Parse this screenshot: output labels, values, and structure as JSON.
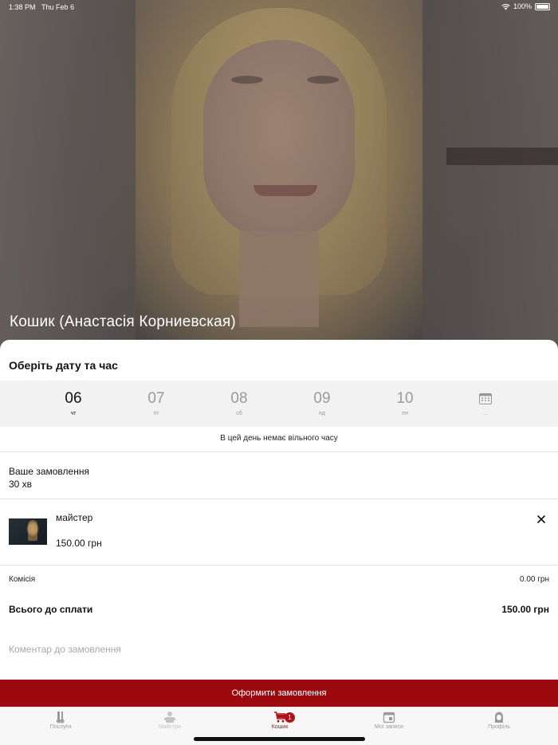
{
  "status_bar": {
    "time": "1:38 PM",
    "date": "Thu Feb 6",
    "battery": "100%"
  },
  "hero": {
    "title": "Кошик (Анастасія Корниевская)"
  },
  "booking": {
    "title": "Оберіть дату та час",
    "days": [
      {
        "num": "06",
        "weekday": "чт",
        "active": true
      },
      {
        "num": "07",
        "weekday": "пт",
        "active": false
      },
      {
        "num": "08",
        "weekday": "сб",
        "active": false
      },
      {
        "num": "09",
        "weekday": "нд",
        "active": false
      },
      {
        "num": "10",
        "weekday": "пн",
        "active": false
      }
    ],
    "calendar_icon": "calendar-icon",
    "more_label": "...",
    "no_time_msg": "В цей день немає вільного часу"
  },
  "order": {
    "label": "Ваше замовлення",
    "duration": "30 хв",
    "items": [
      {
        "name": "майстер",
        "price": "150.00 грн"
      }
    ],
    "fee_label": "Комісія",
    "fee_value": "0.00 грн",
    "total_label": "Всього до сплати",
    "total_value": "150.00 грн",
    "comment_placeholder": "Коментар до замовлення",
    "checkout_label": "Оформити замовлення"
  },
  "tabs": [
    {
      "label": "Послуги",
      "icon": "scissors-icon",
      "state": "off"
    },
    {
      "label": "Майстри",
      "icon": "masters-icon",
      "state": "dim"
    },
    {
      "label": "Кошик",
      "icon": "cart-icon",
      "state": "active",
      "badge": "1"
    },
    {
      "label": "Мої записи",
      "icon": "calendar-icon",
      "state": "off"
    },
    {
      "label": "Профіль",
      "icon": "profile-icon",
      "state": "off"
    }
  ],
  "colors": {
    "accent": "#9c0a10",
    "tab_active": "#b0121a"
  }
}
